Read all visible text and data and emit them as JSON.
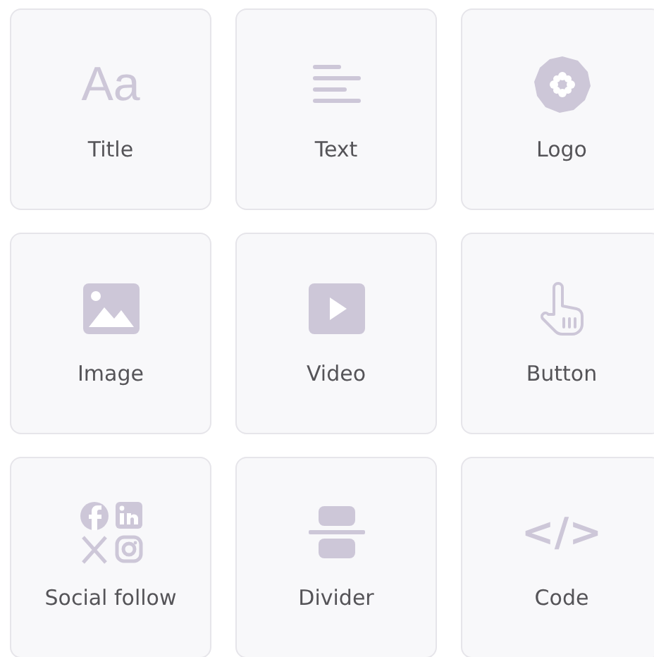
{
  "blocks": [
    {
      "kind": "title",
      "glyph": "Aa",
      "label": "Title"
    },
    {
      "kind": "text",
      "label": "Text"
    },
    {
      "kind": "logo",
      "label": "Logo"
    },
    {
      "kind": "image",
      "label": "Image"
    },
    {
      "kind": "video",
      "label": "Video"
    },
    {
      "kind": "button",
      "label": "Button"
    },
    {
      "kind": "social",
      "label": "Social follow"
    },
    {
      "kind": "divider",
      "label": "Divider"
    },
    {
      "kind": "code",
      "glyph": "</>",
      "label": "Code"
    }
  ]
}
